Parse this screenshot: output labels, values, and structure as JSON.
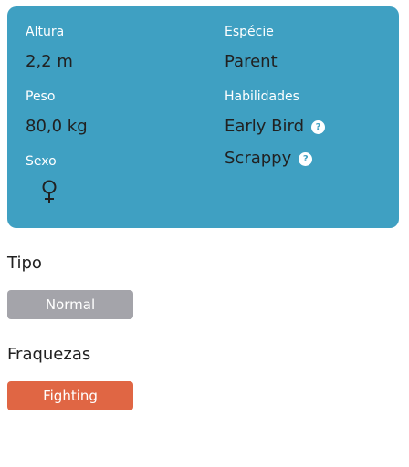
{
  "stats": {
    "height": {
      "label": "Altura",
      "value": "2,2 m"
    },
    "weight": {
      "label": "Peso",
      "value": "80,0 kg"
    },
    "sex": {
      "label": "Sexo",
      "icon": "female-symbol-icon"
    },
    "species": {
      "label": "Espécie",
      "value": "Parent"
    },
    "abilities": {
      "label": "Habilidades",
      "items": [
        {
          "name": "Early Bird",
          "help_icon": "?"
        },
        {
          "name": "Scrappy",
          "help_icon": "?"
        }
      ]
    }
  },
  "type_section": {
    "title": "Tipo",
    "types": [
      {
        "label": "Normal",
        "color": "#a4a4aa"
      }
    ]
  },
  "weakness_section": {
    "title": "Fraquezas",
    "types": [
      {
        "label": "Fighting",
        "color": "#e06644"
      }
    ]
  },
  "colors": {
    "card_background": "#3fa0c2",
    "label_text": "#ffffff",
    "value_text": "#212121"
  }
}
